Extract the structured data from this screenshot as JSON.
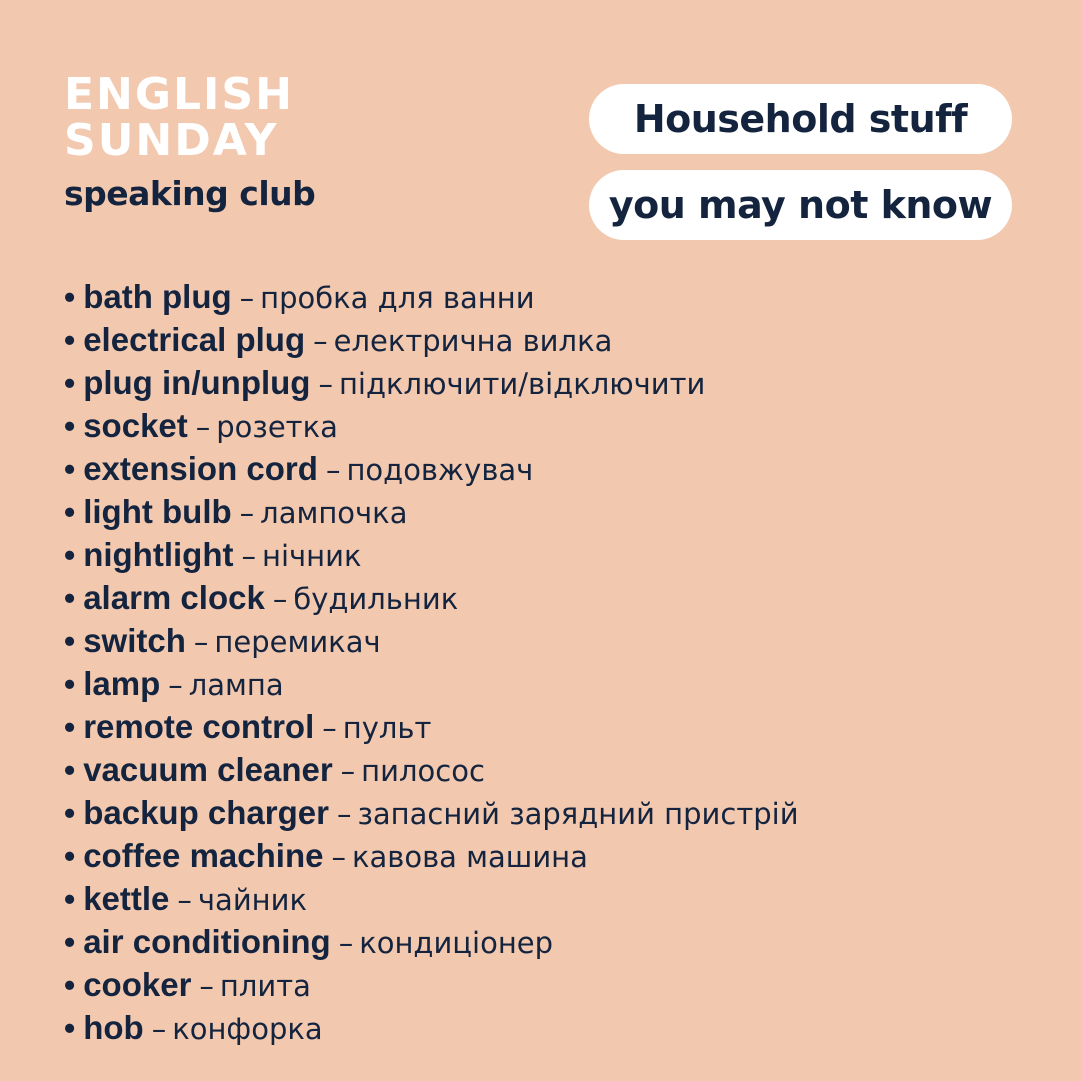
{
  "header": {
    "brand_line1": "ENGLISH",
    "brand_line2": "SUNDAY",
    "brand_sub": "speaking club"
  },
  "topic": {
    "line1": "Household stuff",
    "line2": "you may not know"
  },
  "separator": "–",
  "bullet": "•",
  "colors": {
    "background": "#f2c8af",
    "text": "#14243f",
    "pill": "#ffffff",
    "brand": "#ffffff"
  },
  "vocabulary": [
    {
      "term": "bath plug",
      "translation": "пробка для ванни"
    },
    {
      "term": "electrical plug",
      "translation": "електрична вилка"
    },
    {
      "term": "plug in/unplug",
      "translation": "підключити/відключити"
    },
    {
      "term": "socket",
      "translation": "розетка"
    },
    {
      "term": "extension cord",
      "translation": "подовжувач"
    },
    {
      "term": "light bulb",
      "translation": "лампочка"
    },
    {
      "term": "nightlight",
      "translation": "нічник"
    },
    {
      "term": "alarm clock",
      "translation": "будильник"
    },
    {
      "term": "switch",
      "translation": "перемикач"
    },
    {
      "term": "lamp",
      "translation": "лампа"
    },
    {
      "term": "remote control",
      "translation": "пульт"
    },
    {
      "term": "vacuum cleaner",
      "translation": "пилосос"
    },
    {
      "term": "backup charger",
      "translation": "запасний зарядний пристрій"
    },
    {
      "term": "coffee machine",
      "translation": "кавова машина"
    },
    {
      "term": "kettle",
      "translation": "чайник"
    },
    {
      "term": "air conditioning",
      "translation": "кондиціонер"
    },
    {
      "term": "cooker",
      "translation": "плита"
    },
    {
      "term": "hob",
      "translation": "конфорка"
    }
  ]
}
